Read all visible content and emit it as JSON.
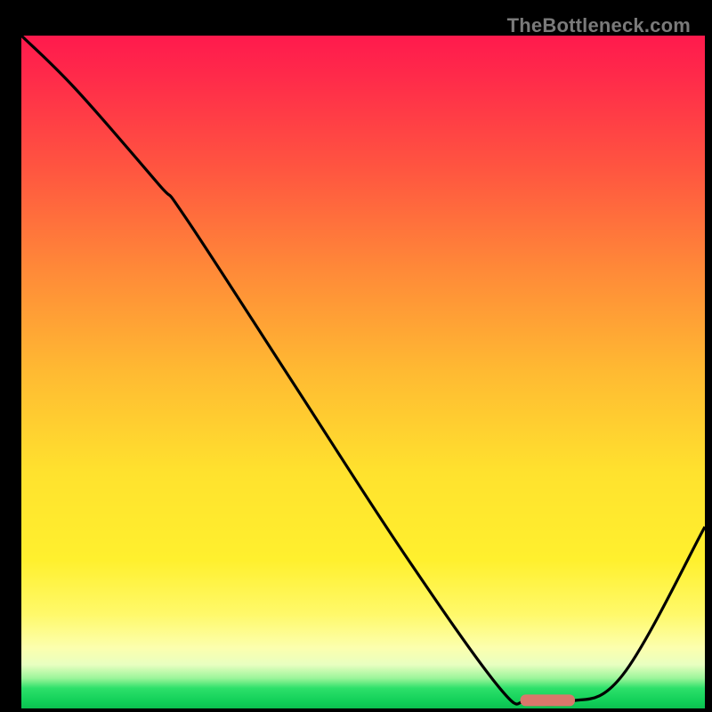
{
  "watermark": "TheBottleneck.com",
  "chart_data": {
    "type": "line",
    "title": "",
    "xlabel": "",
    "ylabel": "",
    "xlim": [
      0,
      100
    ],
    "ylim": [
      0,
      100
    ],
    "grid": false,
    "legend": false,
    "series": [
      {
        "name": "bottleneck-curve",
        "x": [
          0,
          8,
          20,
          24,
          40,
          56,
          70,
          74,
          80,
          88,
          100
        ],
        "y": [
          100,
          92,
          78,
          73,
          48,
          23,
          3,
          1,
          1,
          5,
          27
        ]
      }
    ],
    "marker": {
      "name": "optimal-range",
      "x_start": 73,
      "x_end": 81,
      "y": 1.2,
      "color": "#d9776b"
    },
    "background_gradient": {
      "top": "#ff1a4d",
      "mid": "#ffe22e",
      "bottom": "#10cf58"
    }
  }
}
